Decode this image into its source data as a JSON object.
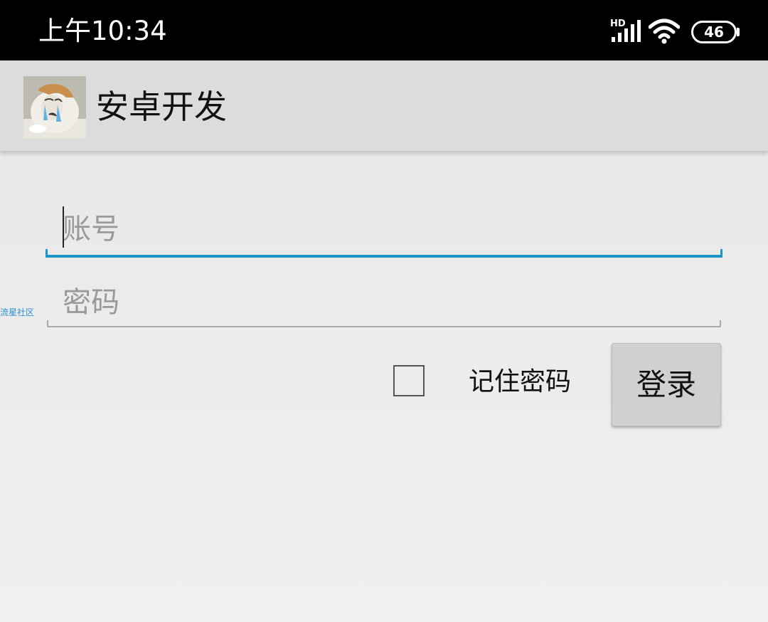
{
  "status_bar": {
    "time": "上午10:34",
    "network_label": "HD",
    "battery_level": "46",
    "icons": [
      "signal-icon",
      "wifi-icon",
      "battery-icon"
    ]
  },
  "app_bar": {
    "title": "安卓开发",
    "logo_icon": "app-logo-avatar"
  },
  "form": {
    "account": {
      "placeholder": "账号",
      "value": ""
    },
    "password": {
      "placeholder": "密码",
      "value": ""
    },
    "remember_label": "记住密码",
    "remember_checked": false,
    "login_label": "登录"
  },
  "watermark": "流星社区",
  "colors": {
    "status_bar_bg": "#000000",
    "app_bar_bg": "#dcdcdc",
    "focus_accent": "#1e96c8",
    "button_bg": "#d0d0d0"
  }
}
